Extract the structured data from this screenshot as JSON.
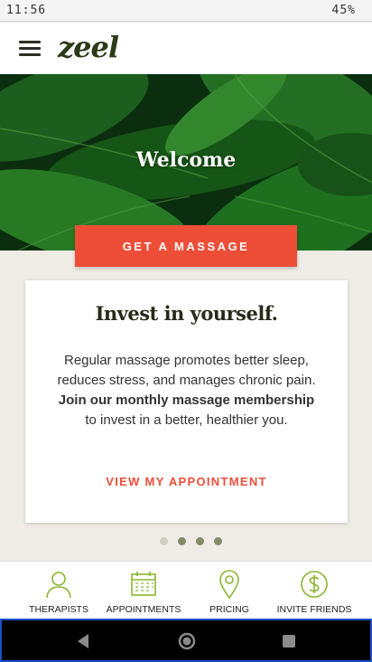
{
  "status_bar": {
    "time": "11:56",
    "battery": "45%"
  },
  "header": {
    "logo": "zeel"
  },
  "hero": {
    "title": "Welcome"
  },
  "cta": {
    "label": "GET A MASSAGE"
  },
  "card": {
    "title": "Invest in yourself.",
    "line1": "Regular massage promotes better sleep,",
    "line2": "reduces stress, and manages chronic pain.",
    "line3_bold": "Join our monthly massage membership",
    "line4": "to invest in a better, healthier you.",
    "link": "VIEW MY APPOINTMENT"
  },
  "carousel": {
    "total": 4,
    "active_index": 0
  },
  "bottom_nav": {
    "items": [
      {
        "label": "THERAPISTS",
        "icon": "person-icon"
      },
      {
        "label": "APPOINTMENTS",
        "icon": "calendar-icon"
      },
      {
        "label": "PRICING",
        "icon": "location-pin-icon"
      },
      {
        "label": "INVITE FRIENDS",
        "icon": "dollar-icon"
      }
    ]
  },
  "colors": {
    "accent": "#ee4e38",
    "nav_icon": "#8ab530",
    "brand": "#2d3a17"
  }
}
